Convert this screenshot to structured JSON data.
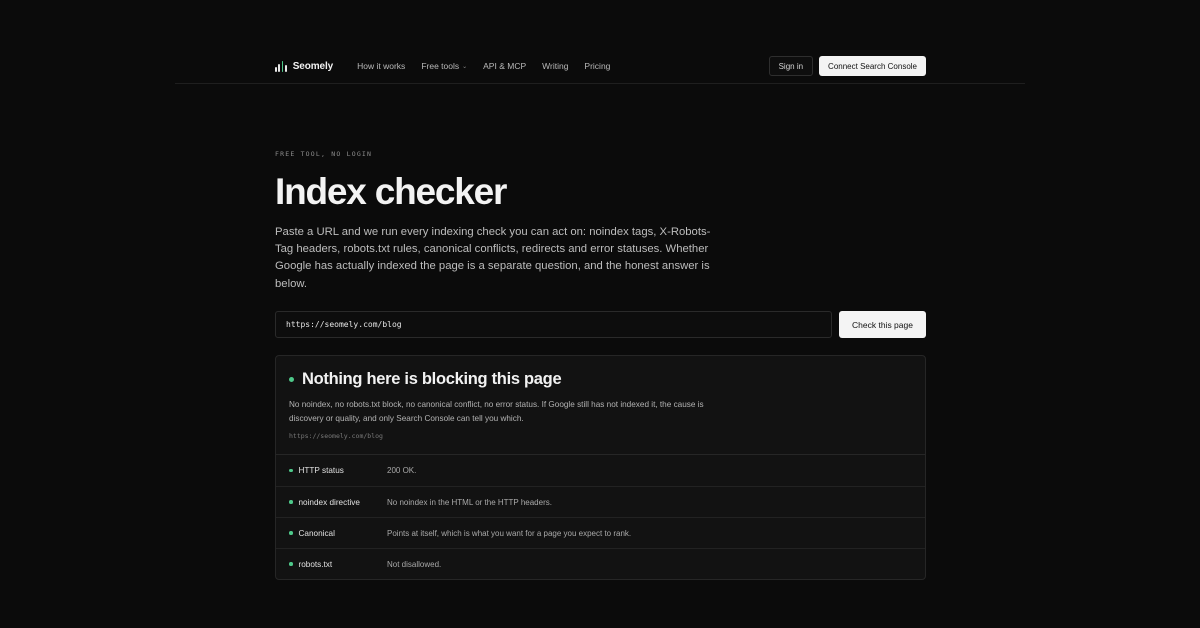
{
  "brand": {
    "name": "Seomely",
    "accent": "#4ec98a"
  },
  "nav": {
    "links": [
      "How it works",
      "Free tools",
      "API & MCP",
      "Writing",
      "Pricing"
    ],
    "sign_in": "Sign in",
    "connect": "Connect Search Console"
  },
  "hero": {
    "eyebrow": "FREE TOOL, NO LOGIN",
    "title": "Index checker",
    "lede": "Paste a URL and we run every indexing check you can act on: noindex tags, X-Robots-Tag headers, robots.txt rules, canonical conflicts, redirects and error statuses. Whether Google has actually indexed the page is a separate question, and the honest answer is below."
  },
  "form": {
    "url_value": "https://seomely.com/blog",
    "submit_label": "Check this page"
  },
  "result": {
    "title": "Nothing here is blocking this page",
    "description": "No noindex, no robots.txt block, no canonical conflict, no error status. If Google still has not indexed it, the cause is discovery or quality, and only Search Console can tell you which.",
    "url": "https://seomely.com/blog",
    "checks": [
      {
        "name": "HTTP status",
        "note": "200 OK."
      },
      {
        "name": "noindex directive",
        "note": "No noindex in the HTML or the HTTP headers."
      },
      {
        "name": "Canonical",
        "note": "Points at itself, which is what you want for a page you expect to rank."
      },
      {
        "name": "robots.txt",
        "note": "Not disallowed."
      }
    ]
  }
}
